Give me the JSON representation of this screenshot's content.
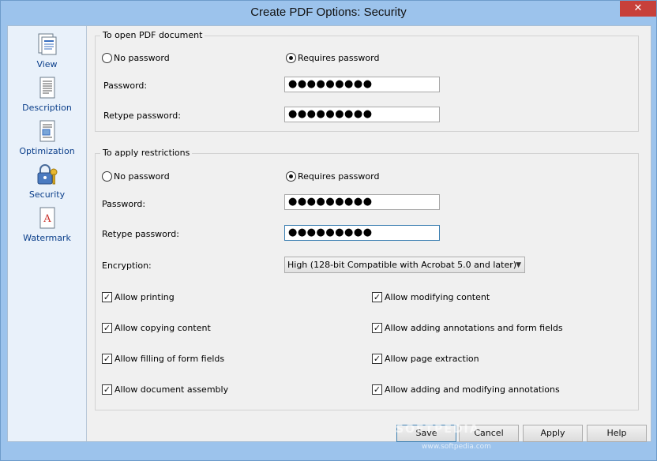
{
  "window": {
    "title": "Create PDF Options: Security",
    "close": "✕"
  },
  "sidebar": {
    "items": [
      {
        "label": "View"
      },
      {
        "label": "Description"
      },
      {
        "label": "Optimization"
      },
      {
        "label": "Security"
      },
      {
        "label": "Watermark"
      }
    ]
  },
  "open_group": {
    "title": "To open PDF document",
    "no_password": "No password",
    "requires_password": "Requires password",
    "password_label": "Password:",
    "password_value": "●●●●●●●●●",
    "retype_label": "Retype password:",
    "retype_value": "●●●●●●●●●"
  },
  "restrict_group": {
    "title": "To apply restrictions",
    "no_password": "No password",
    "requires_password": "Requires password",
    "password_label": "Password:",
    "password_value": "●●●●●●●●●",
    "retype_label": "Retype password:",
    "retype_value": "●●●●●●●●●",
    "encryption_label": "Encryption:",
    "encryption_value": "High (128-bit Compatible with Acrobat 5.0 and later)",
    "permissions": {
      "allow_printing": "Allow printing",
      "allow_copying": "Allow copying content",
      "allow_filling": "Allow filling of form fields",
      "allow_assembly": "Allow document assembly",
      "allow_modifying": "Allow modifying content",
      "allow_annotations_forms": "Allow adding annotations and form fields",
      "allow_extraction": "Allow page extraction",
      "allow_annotations_modify": "Allow adding and modifying annotations"
    }
  },
  "buttons": {
    "save": "Save",
    "cancel": "Cancel",
    "apply": "Apply",
    "help": "Help"
  },
  "watermark": {
    "text": "SOFTPEDIA",
    "url": "www.softpedia.com"
  }
}
